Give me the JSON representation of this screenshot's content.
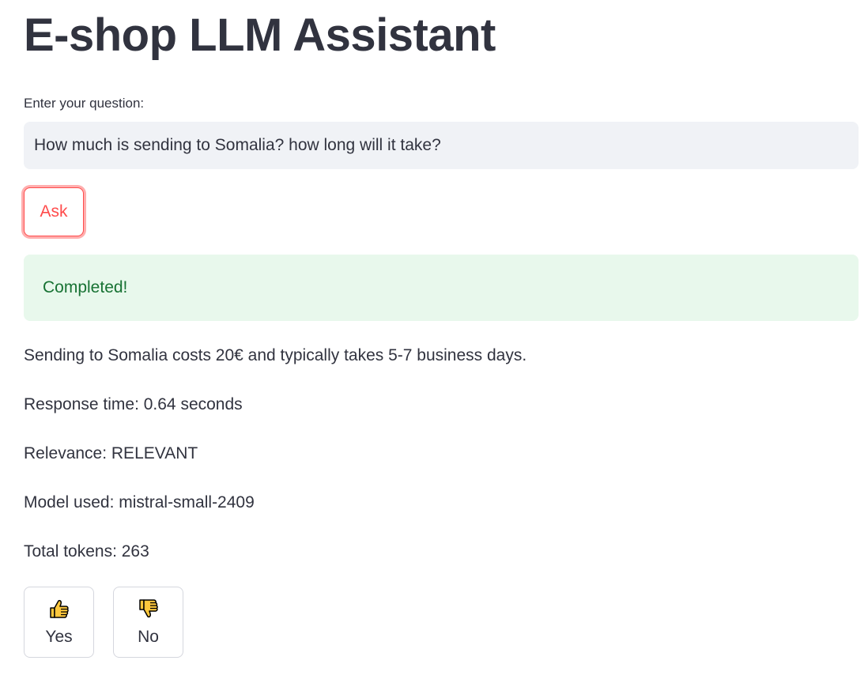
{
  "header": {
    "title": "E-shop LLM Assistant"
  },
  "question": {
    "label": "Enter your question:",
    "value": "How much is sending to Somalia? how long will it take?"
  },
  "ask_button": {
    "label": "Ask"
  },
  "status": {
    "text": "Completed!",
    "color": "#177233",
    "background": "#e8f8ec"
  },
  "result": {
    "answer": "Sending to Somalia costs 20€ and typically takes 5-7 business days.",
    "response_time": "Response time: 0.64 seconds",
    "relevance": "Relevance: RELEVANT",
    "model": "Model used: mistral-small-2409",
    "tokens": "Total tokens: 263"
  },
  "feedback": {
    "yes": {
      "icon": "thumbs-up-icon",
      "label": "Yes"
    },
    "no": {
      "icon": "thumbs-down-icon",
      "label": "No"
    }
  },
  "colors": {
    "accent": "#ff4b4b",
    "text": "#31333f",
    "input_background": "#f0f2f6",
    "emoji_yellow": "#ffc83d"
  }
}
